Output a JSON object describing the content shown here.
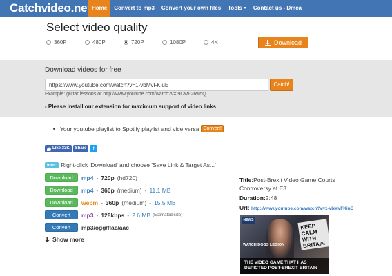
{
  "navbar": {
    "brand": "Catchvideo.net",
    "items": [
      {
        "label": "Home"
      },
      {
        "label": "Convert to mp3"
      },
      {
        "label": "Convert your own files"
      },
      {
        "label": "Tools"
      },
      {
        "label": "Contact us - Dmca"
      }
    ],
    "colors": {
      "bar": "#4275b4",
      "active": "#e8841c"
    }
  },
  "quality": {
    "title": "Select video quality",
    "options": [
      "360P",
      "480P",
      "720P",
      "1080P",
      "4K"
    ],
    "selected": "720P",
    "download_label": "Download"
  },
  "search": {
    "title": "Download videos for free",
    "input_value": "https://www.youtube.com/watch?v=1-vbMvFKiuE",
    "catch_label": "Catch!",
    "example": "Example: guitar lessons or http://www.youtube.com/watch?v=I9Law-26wdQ",
    "install_message": "- Please install our extension for maximum support of video links"
  },
  "playlist": {
    "text": "Your youtube playlist to Spotify playlist and vice versa",
    "button": "Convert!"
  },
  "social": {
    "like_label": "Like 33K",
    "share_label": "Share",
    "twitter_glyph": "t"
  },
  "info": {
    "label": "Info:",
    "text": "Right-click 'Download' and choose 'Save Link & Target As...'"
  },
  "downloads": [
    {
      "button": "Download",
      "format": "mp4",
      "resolution": "720p",
      "note": "(hd720)",
      "size": ""
    },
    {
      "button": "Download",
      "format": "mp4",
      "resolution": "360p",
      "note": "(medium)",
      "size": "11.1 MB"
    },
    {
      "button": "Download",
      "format": "webm",
      "resolution": "360p",
      "note": "(medium)",
      "size": "15.5 MB"
    },
    {
      "button": "Convert",
      "format": "mp3",
      "resolution": "128kbps",
      "note": "",
      "size": "2.6 MB",
      "estimate": "(Estimated size)"
    },
    {
      "button": "Convert",
      "format": "mp3/ogg/flac/aac"
    }
  ],
  "show_more": "Show more",
  "video": {
    "title_label": "Title:",
    "title": "Post-Brexit Video Game Courts Controversy at E3",
    "duration_label": "Duration:",
    "duration": "2:48",
    "url_label": "Url:",
    "url": "http://www.youtube.com/watch?v=1-vbMvFKiuE",
    "thumbnail": {
      "news_badge": "NEWS",
      "sign_text": "KEEP CALM WITH BRITAIN",
      "game_logo": "WATCH DOGS LEGION",
      "caption": "THE VIDEO GAME THAT HAS DEPICTED POST-BREXIT BRITAIN"
    }
  },
  "icons": {
    "download": "download-icon",
    "show_more": "arrow-down-icon"
  }
}
